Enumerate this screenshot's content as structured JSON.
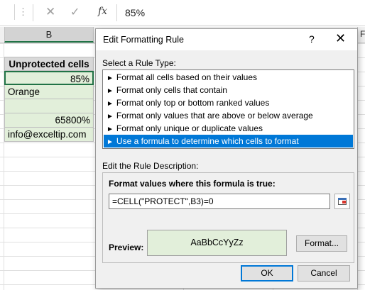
{
  "formula_bar": {
    "dots": "⋮",
    "cancel_icon": "✕",
    "enter_icon": "✓",
    "fx_label": "fx",
    "value": "85%"
  },
  "columns": {
    "b": "B",
    "f": "F"
  },
  "cells": [
    {
      "value": "Unprotected cells"
    },
    {
      "value": "85%"
    },
    {
      "value": "Orange"
    },
    {
      "value": ""
    },
    {
      "value": "65800%"
    },
    {
      "value": "info@exceltip.com"
    }
  ],
  "dialog": {
    "title": "Edit Formatting Rule",
    "help": "?",
    "close": "✕",
    "select_rule_type_label": "Select a Rule Type:",
    "rule_types": [
      "Format all cells based on their values",
      "Format only cells that contain",
      "Format only top or bottom ranked values",
      "Format only values that are above or below average",
      "Format only unique or duplicate values",
      "Use a formula to determine which cells to format"
    ],
    "selected_rule_index": 5,
    "edit_description_label": "Edit the Rule Description:",
    "formula_heading": "Format values where this formula is true:",
    "formula_value": "=CELL(\"PROTECT\",B3)=0",
    "preview_label": "Preview:",
    "preview_text": "AaBbCcYyZz",
    "format_button": "Format...",
    "ok_button": "OK",
    "cancel_button": "Cancel"
  },
  "colors": {
    "excel_green": "#217346",
    "fill_green": "#e2efda",
    "header_gray": "#d9d9d9",
    "selection_blue": "#0078d7"
  }
}
